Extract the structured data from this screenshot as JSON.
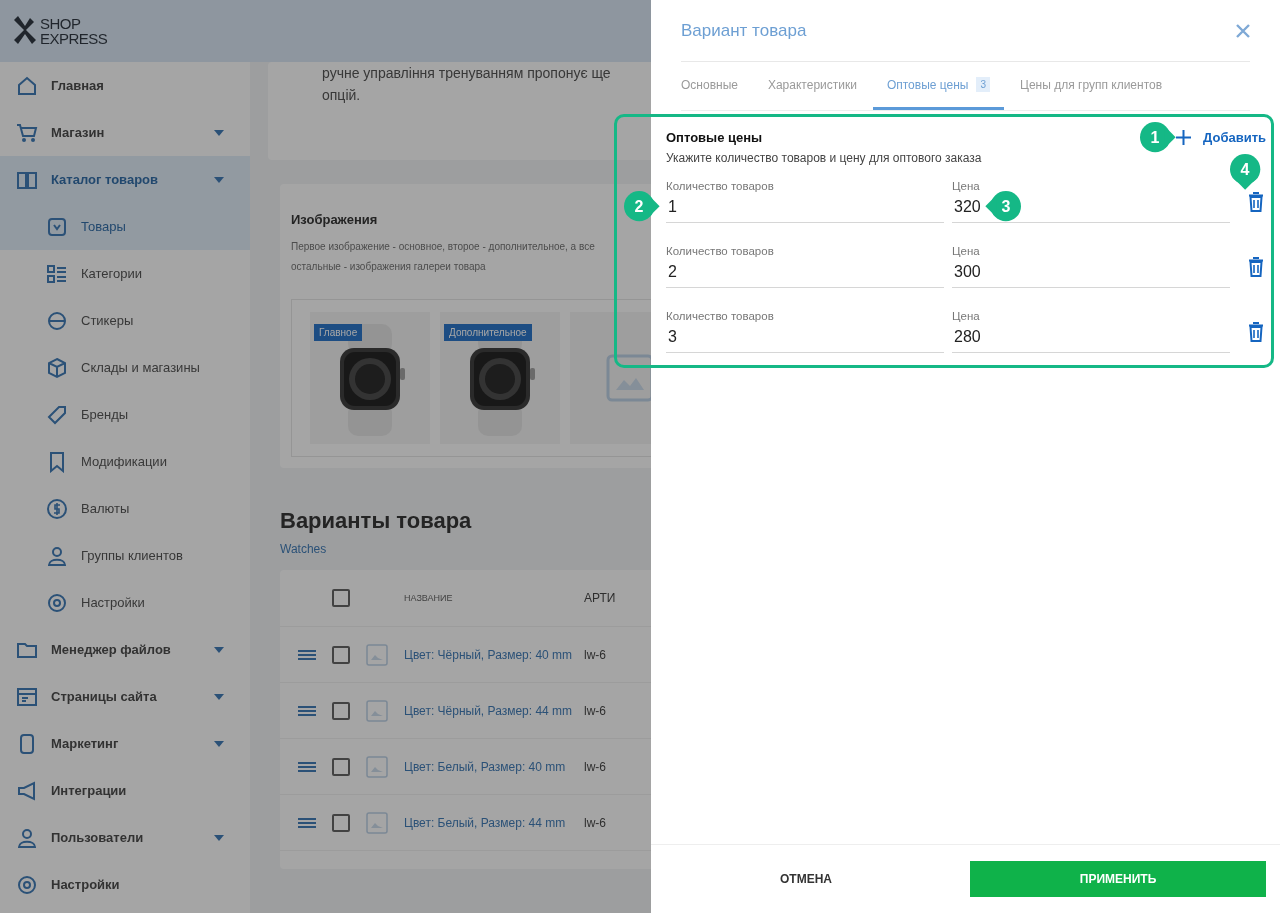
{
  "sidebar": {
    "logo": [
      "SHOP",
      "EXPRESS"
    ],
    "items": [
      {
        "label": "Главная",
        "caret": false,
        "selected": false
      },
      {
        "label": "Магазин",
        "caret": true,
        "selected": false
      },
      {
        "label": "Каталог товаров",
        "caret": true,
        "selected": true,
        "children": [
          {
            "label": "Товары",
            "selected": true
          },
          {
            "label": "Категории",
            "selected": false
          },
          {
            "label": "Стикеры",
            "selected": false
          },
          {
            "label": "Склады и магазины",
            "selected": false
          },
          {
            "label": "Бренды",
            "selected": false
          },
          {
            "label": "Модификации",
            "selected": false
          },
          {
            "label": "Валюты",
            "selected": false
          },
          {
            "label": "Группы клиентов",
            "selected": false
          },
          {
            "label": "Настройки",
            "selected": false
          }
        ]
      },
      {
        "label": "Менеджер файлов",
        "caret": true,
        "selected": false
      },
      {
        "label": "Страницы сайта",
        "caret": true,
        "selected": false
      },
      {
        "label": "Маркетинг",
        "caret": true,
        "selected": false
      },
      {
        "label": "Интеграции",
        "caret": false,
        "selected": false
      },
      {
        "label": "Пользователи",
        "caret": true,
        "selected": false
      },
      {
        "label": "Настройки",
        "caret": false,
        "selected": false
      }
    ]
  },
  "description_card": {
    "lines": [
      "ручне управління тренуванням пропонує ще",
      "опцій."
    ]
  },
  "images": {
    "title": "Изображения",
    "description_lines": [
      "Первое изображение - основное, второе - дополнительное, а все",
      "остальные - изображения галереи товара"
    ],
    "thumbnails": [
      {
        "kind": "picture",
        "badge": "Главное"
      },
      {
        "kind": "picture",
        "badge": "Дополнительное"
      },
      {
        "kind": "placeholder"
      }
    ]
  },
  "variants": {
    "title": "Варианты товара",
    "link": "Watches",
    "columns": [
      "НАЗВАНИЕ",
      "АРТИ"
    ],
    "header_checked": false,
    "rows": [
      {
        "name": "Цвет: Чёрный, Размер: 40 mm",
        "sku": "lw-6",
        "checked": false
      },
      {
        "name": "Цвет: Чёрный, Размер: 44 mm",
        "sku": "lw-6",
        "checked": false
      },
      {
        "name": "Цвет: Белый, Размер: 40 mm",
        "sku": "lw-6",
        "checked": false
      },
      {
        "name": "Цвет: Белый, Размер: 44 mm",
        "sku": "lw-6",
        "checked": false
      }
    ]
  },
  "dialog": {
    "title": "Вариант товара",
    "tabs": [
      {
        "label": "Основные",
        "selected": false
      },
      {
        "label": "Характеристики",
        "selected": false
      },
      {
        "label": "Оптовые цены",
        "badge": "3",
        "selected": true
      },
      {
        "label": "Цены для групп клиентов",
        "selected": false
      }
    ],
    "section": {
      "title": "Оптовые цены",
      "description": "Укажите количество товаров и цену для оптового заказа",
      "add_label": "Добавить",
      "rows": [
        {
          "quantity_label": "Количество товаров",
          "quantity": "1",
          "price_label": "Цена",
          "price": "320"
        },
        {
          "quantity_label": "Количество товаров",
          "quantity": "2",
          "price_label": "Цена",
          "price": "300"
        },
        {
          "quantity_label": "Количество товаров",
          "quantity": "3",
          "price_label": "Цена",
          "price": "280"
        }
      ]
    },
    "cancel": "ОТМЕНА",
    "apply": "ПРИМЕНИТЬ"
  },
  "callouts": [
    {
      "label": "1"
    },
    {
      "label": "2"
    },
    {
      "label": "3"
    },
    {
      "label": "4"
    }
  ]
}
